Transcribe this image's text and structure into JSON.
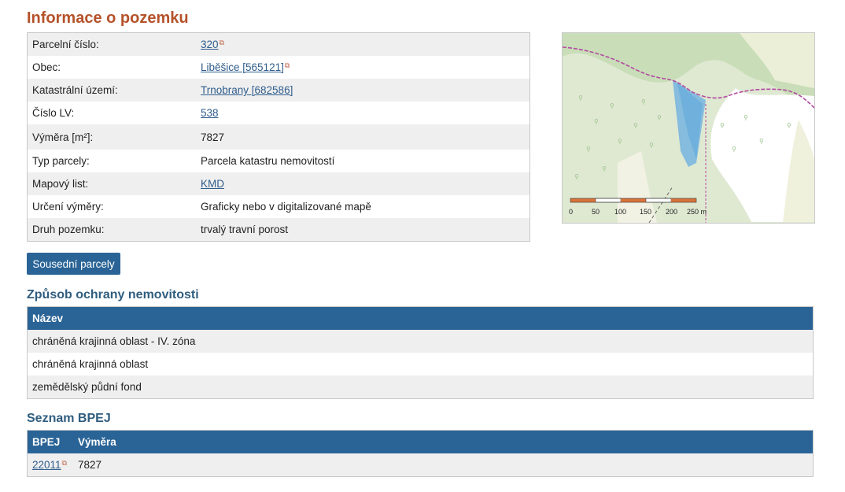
{
  "page": {
    "title": "Informace o pozemku"
  },
  "info_rows": [
    {
      "label": "Parcelní číslo:",
      "value": "320",
      "link": true,
      "ext": true
    },
    {
      "label": "Obec:",
      "value": "Liběšice [565121]",
      "link": true,
      "ext": true
    },
    {
      "label": "Katastrální území:",
      "value": "Trnobrany [682586]",
      "link": true,
      "ext": false
    },
    {
      "label": "Číslo LV:",
      "value": "538",
      "link": true,
      "ext": false
    },
    {
      "label": "Výměra [m²]:",
      "value": "7827",
      "link": false,
      "ext": false
    },
    {
      "label": "Typ parcely:",
      "value": "Parcela katastru nemovitostí",
      "link": false,
      "ext": false
    },
    {
      "label": "Mapový list:",
      "value": "KMD",
      "link": true,
      "ext": false
    },
    {
      "label": "Určení výměry:",
      "value": "Graficky nebo v digitalizované mapě",
      "link": false,
      "ext": false
    },
    {
      "label": "Druh pozemku:",
      "value": "trvalý travní porost",
      "link": false,
      "ext": false
    }
  ],
  "map": {
    "scale_labels": [
      "0",
      "50",
      "100",
      "150",
      "200",
      "250 m"
    ]
  },
  "neighbors_button": "Sousední parcely",
  "protection": {
    "heading": "Způsob ochrany nemovitosti",
    "column": "Název",
    "rows": [
      "chráněná krajinná oblast - IV. zóna",
      "chráněná krajinná oblast",
      "zemědělský půdní fond"
    ]
  },
  "bpej": {
    "heading": "Seznam BPEJ",
    "columns": [
      "BPEJ",
      "Výměra"
    ],
    "rows": [
      {
        "code": "22011",
        "area": "7827"
      }
    ]
  },
  "colors": {
    "accent": "#2a6496",
    "title": "#b5522a",
    "link": "#2f5d8c"
  }
}
